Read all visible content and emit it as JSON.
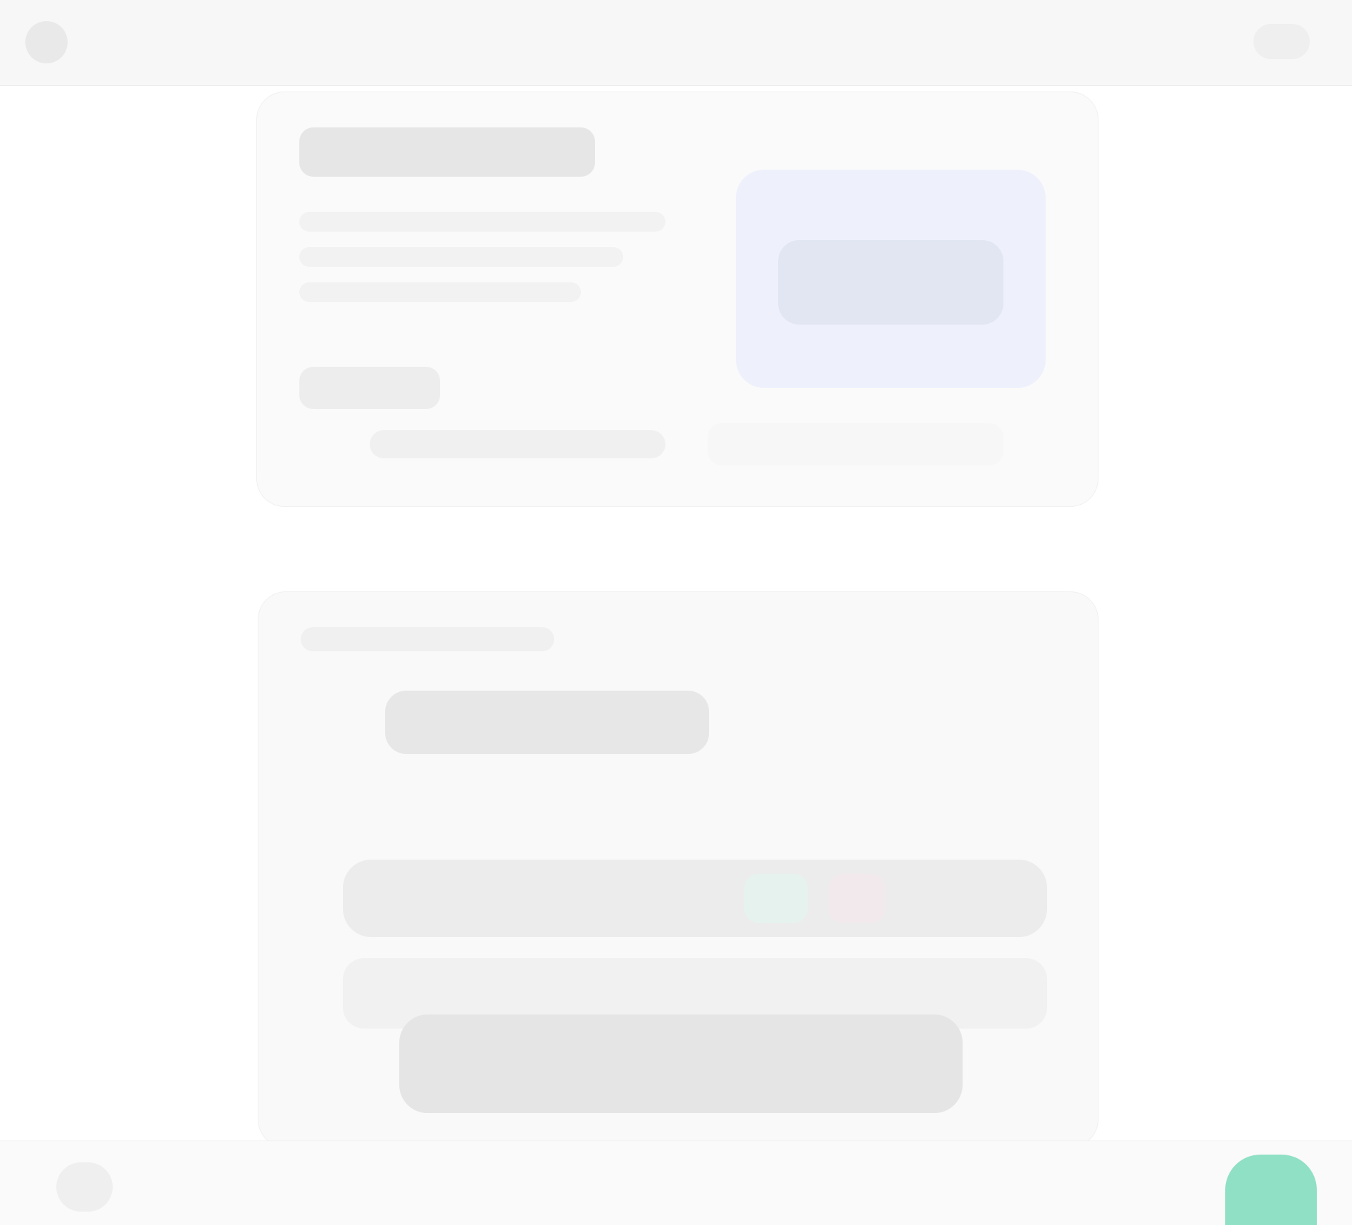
{
  "header": {
    "app_icon": "app-icon",
    "account_icon": "account-icon"
  },
  "card1": {
    "title": "",
    "subtitle_lines": [
      "",
      "",
      ""
    ],
    "tile_icon": "image-icon",
    "meta": [
      "",
      "",
      ""
    ]
  },
  "card2": {
    "heading_small": "",
    "heading_big": "",
    "row_primary": "",
    "status_labels": [
      "",
      ""
    ],
    "row_secondary": "",
    "row_tertiary": ""
  },
  "bottom_bar": {
    "left_icon": "menu-icon"
  },
  "fab": {
    "label": "",
    "icon": "plus-icon",
    "color": "#8fe0c4"
  },
  "colors": {
    "tile_blue": "#eef1fb",
    "status_green": "#e6f2ee",
    "status_red": "#f2e9ec"
  }
}
